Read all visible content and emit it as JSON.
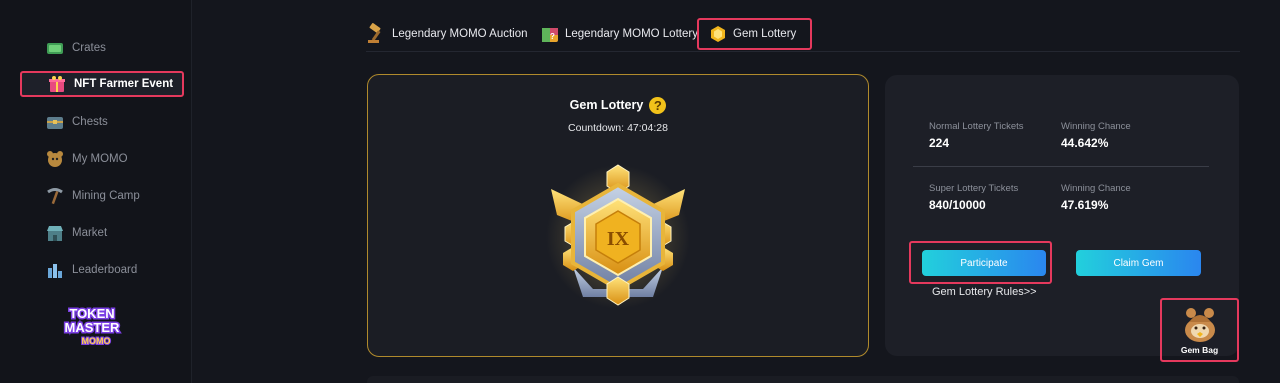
{
  "sidebar": {
    "items": [
      {
        "label": "Crates",
        "icon": "crate-icon"
      },
      {
        "label": "NFT Farmer Event",
        "icon": "gift-icon"
      },
      {
        "label": "Chests",
        "icon": "chest-icon"
      },
      {
        "label": "My MOMO",
        "icon": "momo-icon"
      },
      {
        "label": "Mining Camp",
        "icon": "pickaxe-icon"
      },
      {
        "label": "Market",
        "icon": "market-icon"
      },
      {
        "label": "Leaderboard",
        "icon": "leaderboard-icon"
      }
    ],
    "logo": {
      "line1": "TOKEN",
      "line2": "MASTER",
      "line3": "MOMO"
    }
  },
  "tabs": [
    {
      "label": "Legendary MOMO Auction",
      "icon": "gavel-icon"
    },
    {
      "label": "Legendary MOMO Lottery",
      "icon": "mystery-box-icon"
    },
    {
      "label": "Gem Lottery",
      "icon": "gem-icon"
    }
  ],
  "lottery": {
    "title": "Gem Lottery",
    "help": "?",
    "countdown_label": "Countdown:",
    "countdown_value": "47:04:28",
    "badge_numeral": "IX"
  },
  "stats": {
    "normal_label": "Normal Lottery Tickets",
    "normal_value": "224",
    "normal_chance_label": "Winning Chance",
    "normal_chance_value": "44.642%",
    "super_label": "Super Lottery Tickets",
    "super_value": "840/10000",
    "super_chance_label": "Winning Chance",
    "super_chance_value": "47.619%"
  },
  "actions": {
    "participate": "Participate",
    "claim": "Claim Gem",
    "rules": "Gem Lottery Rules>>",
    "gem_bag": "Gem Bag"
  },
  "colors": {
    "highlight": "#e5395d",
    "button_start": "#22d0dc",
    "button_end": "#2a86ef",
    "gold": "#f2c21a"
  }
}
